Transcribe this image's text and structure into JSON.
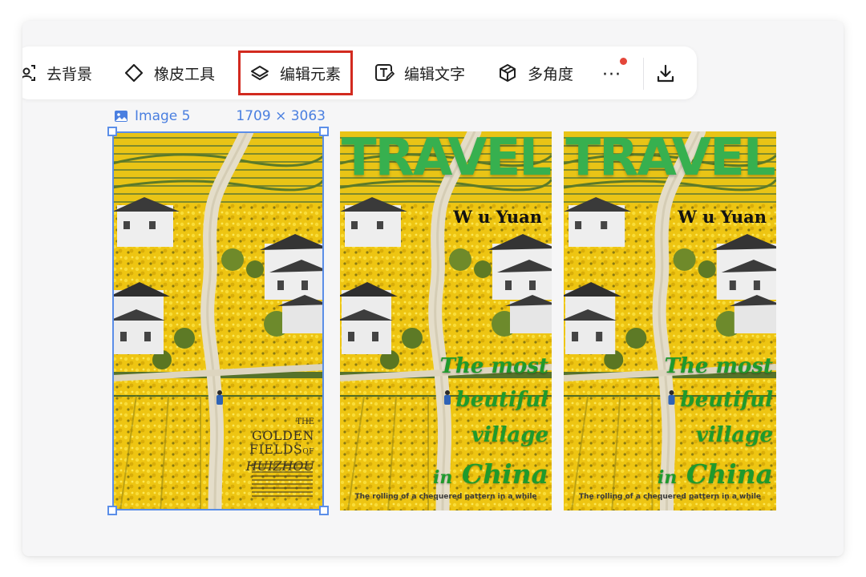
{
  "toolbar": {
    "items": [
      {
        "label": "去背景",
        "icon": "remove-background-icon"
      },
      {
        "label": "橡皮工具",
        "icon": "eraser-icon"
      },
      {
        "label": "编辑元素",
        "icon": "layers-icon",
        "active": true
      },
      {
        "label": "编辑文字",
        "icon": "edit-text-icon"
      },
      {
        "label": "多角度",
        "icon": "cube-icon"
      }
    ],
    "more_label": "···",
    "more_icon": "more-icon",
    "download_icon": "download-icon",
    "active_outline_color": "#d22a1f",
    "notification_dot_color": "#e4463a"
  },
  "selection": {
    "name": "Image 5",
    "dimensions": "1709 × 3063",
    "icon": "image-icon",
    "accent_color": "#4a7fe0"
  },
  "images": [
    {
      "id": "image-5",
      "golden": {
        "line1": "THE",
        "line2": "GOLDEN",
        "line3": "FIELDS",
        "line3_suffix": "OF",
        "line4": "HUIZHOU"
      }
    },
    {
      "title": "TRAVEL",
      "place": "W u Yuan",
      "tagline": [
        "The most",
        "beutiful",
        "village",
        "in China"
      ],
      "tagline_in": "in",
      "tagline_country": "China",
      "footer": "The rolling of a chequered pattern in a while"
    },
    {
      "title": "TRAVEL",
      "place": "W u Yuan",
      "tagline": [
        "The most",
        "beutiful",
        "village",
        "in China"
      ],
      "tagline_in": "in",
      "tagline_country": "China",
      "footer": "The rolling of a chequered pattern in a while"
    }
  ],
  "colors": {
    "travel_title": "#37b04f",
    "tagline": "#1f9a2c",
    "canola_yellow": "#f2c70a",
    "selection_border": "#5b8ee8"
  }
}
